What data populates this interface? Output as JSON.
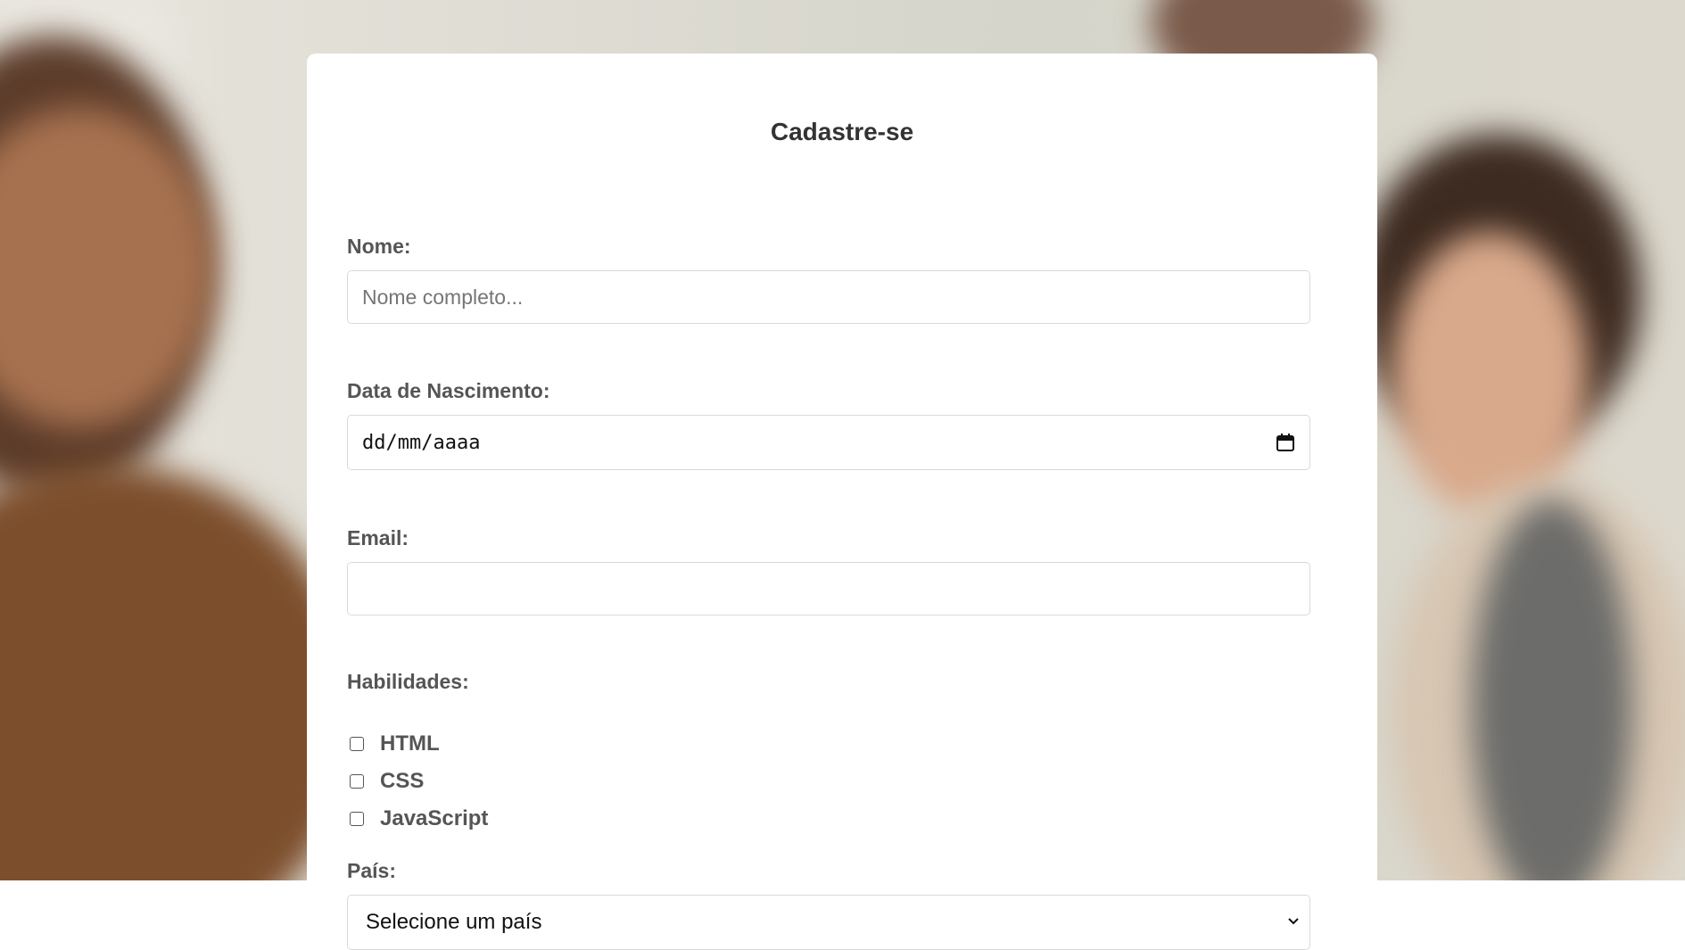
{
  "form": {
    "title": "Cadastre-se",
    "name_label": "Nome:",
    "name_placeholder": "Nome completo...",
    "name_value": "",
    "birth_label": "Data de Nascimento:",
    "birth_placeholder": "dd/mm/aaaa",
    "email_label": "Email:",
    "email_value": "",
    "skills_label": "Habilidades:",
    "skills": [
      {
        "label": "HTML",
        "checked": false
      },
      {
        "label": "CSS",
        "checked": false
      },
      {
        "label": "JavaScript",
        "checked": false
      }
    ],
    "country_label": "País:",
    "country_selected": "Selecione um país"
  },
  "icons": {
    "date_picker": "calendar-icon",
    "select_arrow": "chevron-down-icon"
  },
  "colors": {
    "card_background": "#ffffff",
    "label_text": "#555555",
    "title_text": "#333333",
    "input_border": "#d9d9d9"
  }
}
